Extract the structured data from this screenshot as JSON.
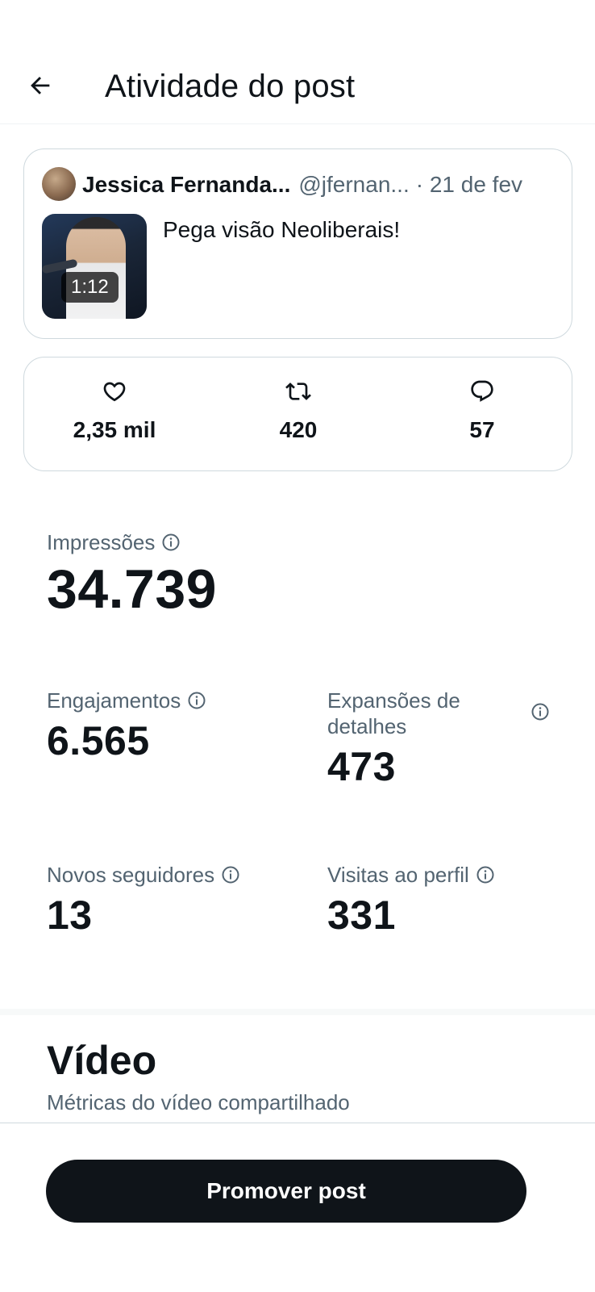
{
  "header": {
    "title": "Atividade do post",
    "back_icon": "arrow-left-icon"
  },
  "post": {
    "author_name": "Jessica Fernanda...",
    "author_handle": "@jfernan...",
    "date": "· 21 de fev",
    "text": "Pega visão Neoliberais!",
    "video_duration": "1:12"
  },
  "engagement": {
    "likes": {
      "value": "2,35 mil",
      "icon": "heart-icon"
    },
    "reposts": {
      "value": "420",
      "icon": "repost-icon"
    },
    "replies": {
      "value": "57",
      "icon": "reply-icon"
    }
  },
  "metrics": {
    "impressions": {
      "label": "Impressões",
      "value": "34.739"
    },
    "engagements": {
      "label": "Engajamentos",
      "value": "6.565"
    },
    "detail_expands": {
      "label": "Expansões de detalhes",
      "value": "473"
    },
    "new_followers": {
      "label": "Novos seguidores",
      "value": "13"
    },
    "profile_visits": {
      "label": "Visitas ao perfil",
      "value": "331"
    }
  },
  "video_section": {
    "title": "Vídeo",
    "subtitle": "Métricas do vídeo compartilhado"
  },
  "promote": {
    "label": "Promover post"
  },
  "colors": {
    "text_primary": "#0f1419",
    "text_secondary": "#536471",
    "border": "#cfd9de",
    "button_bg": "#0f1419"
  }
}
